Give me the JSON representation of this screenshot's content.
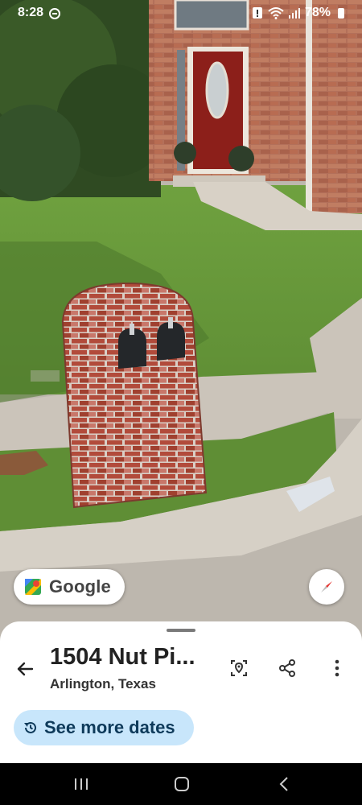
{
  "status_bar": {
    "time": "8:28",
    "battery": "78%",
    "icons": [
      "do-not-disturb-icon",
      "sim-alert-icon",
      "wifi-icon",
      "signal-icon",
      "battery-icon"
    ]
  },
  "overlay": {
    "google_label": "Google",
    "google_icon": "google-maps-icon",
    "compass_icon": "compass-icon"
  },
  "sheet": {
    "title": "1504 Nut Pi...",
    "subtitle": "Arlington, Texas",
    "back_icon": "arrow-back-icon",
    "actions": [
      "location-pin-icon",
      "share-icon",
      "more-vert-icon"
    ],
    "see_more_label": "See more dates",
    "see_more_icon": "history-icon"
  },
  "nav_bar": {
    "buttons": [
      "recent-apps-icon",
      "home-icon",
      "back-icon"
    ]
  },
  "colors": {
    "accent_chip": "#c8e6fb",
    "brick": "#a8503f",
    "grass": "#6b9a3c",
    "door": "#8c1f1a"
  }
}
